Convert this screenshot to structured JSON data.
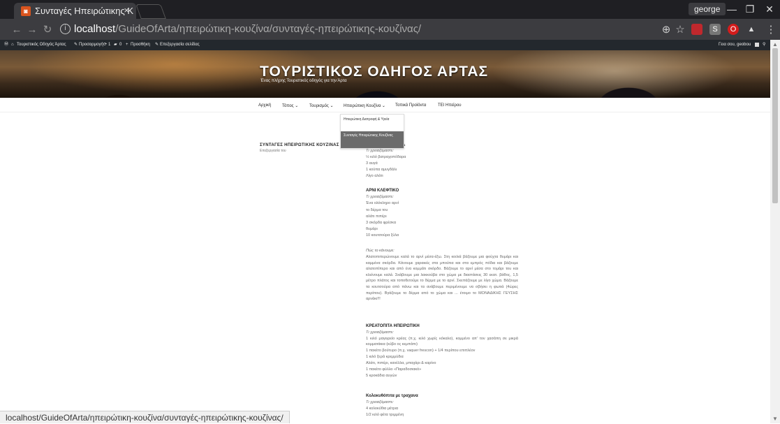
{
  "browser": {
    "tab_title": "Συνταγές Ηπειρώτικης Κ",
    "tab_close": "×",
    "user": "george",
    "url_host": "localhost",
    "url_path": "/GuideOfArta/ηπειρώτικη-κουζίνα/συνταγές-ηπειρώτικης-κουζίνας/"
  },
  "wpbar": {
    "site": "Τουριστικός Οδηγός Άρτας",
    "customize": "Προσαρμογή",
    "updates": "1",
    "comments": "0",
    "new": "Προσθήκη",
    "edit": "Επεξεργασία σελίδας",
    "greeting": "Γεια σου, geobou"
  },
  "site": {
    "title": "ΤΟΥΡΙΣΤΙΚΟΣ ΟΔΗΓΟΣ ΑΡΤΑΣ",
    "tagline": "Ένας πλήρης Τουριστικός οδηγός για την Άρτα"
  },
  "menu": {
    "home": "Αρχική",
    "place": "Τόπος",
    "tourism": "Τουρισμός",
    "cuisine": "Ηπειρώτικη Κουζίνα",
    "local": "Τοπικά Προϊόντα",
    "tei": "ΤΕΙ Ηπείρου",
    "chev": "⌄"
  },
  "dropdown": {
    "item1": "Ηπειρώτικη Διατροφή & Υγεία",
    "item2": "Συνταγές Ηπειρώτικης Κουζίνας"
  },
  "sidebar": {
    "title": "ΣΥΝΤΑΓΕΣ ΗΠΕΙΡΩΤΙΚΗΣ ΚΟΥΖΙΝΑΣ",
    "edit": "Επεξεργασία του"
  },
  "recipes": {
    "r1_title_tail": "Α",
    "r1_need": "Τι χρειαζόμαστε:",
    "r1_l1": "½ κιλό βατραχοπόδαρα",
    "r1_l2": "3 αυγά",
    "r1_l3": "1 κούπα αμυγδάλι",
    "r1_l4": "Λίγο αλάτι",
    "r2_title": "ΑΡΝΙ ΚΛΕΦΤΙΚΟ",
    "r2_need": "Τι χρειαζόμαστε:",
    "r2_l1": "Ένα ολόκληρο αρνί",
    "r2_l2": "το δέρμα του",
    "r2_l3": "αλάτι πιπέρι",
    "r2_l4": "3 σκόρδα φρέσκα",
    "r2_l5": "θυμάρι",
    "r2_l6": "10 κουτσούρα ξύλα",
    "r2_how": "Πώς το κάνουμε:",
    "r2_text": "Αλατοπιπερώνουμε καλά το αρνί μέσα-έξω. Στη κοιλιά βάζουμε μια φούχτα θυμάρι και καμμένα σκόρδα. Κάνουμε χαρακιές στα μπούτια και στα εμπρός πόδια και βάζουμε αλατοπίπερο και από ένα κομμάτι σκόρδο. Βάζουμε το αρνί μέσα στο τομάρι του και κλείνουμε καλά. Σκάβουμε μια λακκούβα στο χώμα με διαστάσεις 30 εκατ. βάθος, 1,5 μέτρο πλάτος και τοποθετούμε το δέρμα με το αρνί. Σκεπάζουμε με λίγο χώμα. Βάζουμε τα κουτσούρα από πάνω και τα ανάβουμε περιμένουμε να σβήσει η φωτιά (4ώρες περίπου). Βγάζουμε το δέρμα από το χώμα και ... έτοιμο το ΜΟΝΑΔΙΚΗΣ ΓΕΥΣΗΣ αρνάκι!!!",
    "r3_title": "ΚΡΕΑΤΟΠΙΤΑ ΗΠΕΙΡΩΤΙΚΗ",
    "r3_need": "Τι χρειαζόμαστε:",
    "r3_l1": "1 κιλό μαγειρείο κρέας (π.χ. κιλό χωρίς κόκαλο), κομμένο απ' τον χασάπη σε μικρά κομματάκια (κύβο ος κεμπάπι)",
    "r3_l2": "1 πακέτο βούτυρο (π.χ. vaquer frescon) + 1/4 περίπου επιπλέον",
    "r3_l3": "1 κιλό ξερά κρεμμύδια",
    "r3_l4": "Αλάτι, πιπέρι, κανέλλα, μπαχάρι & καρίνο",
    "r3_l5": "1 πακέτο φύλλο «Παραδοσιακό»",
    "r3_l6": "5 κροκάδια αυγών",
    "r4_title": "Κολοκυθόπιτα με τραχανα",
    "r4_need": "Τι χρειαζόμαστε:",
    "r4_l1": "4 κολοκύθια μέτρια",
    "r4_l2": "1/2 κιλό φέτα τριμμένη"
  },
  "status_url": "localhost/GuideOfArta/ηπειρώτικη-κουζίνα/συνταγές-ηπειρώτικης-κουζίνας/"
}
